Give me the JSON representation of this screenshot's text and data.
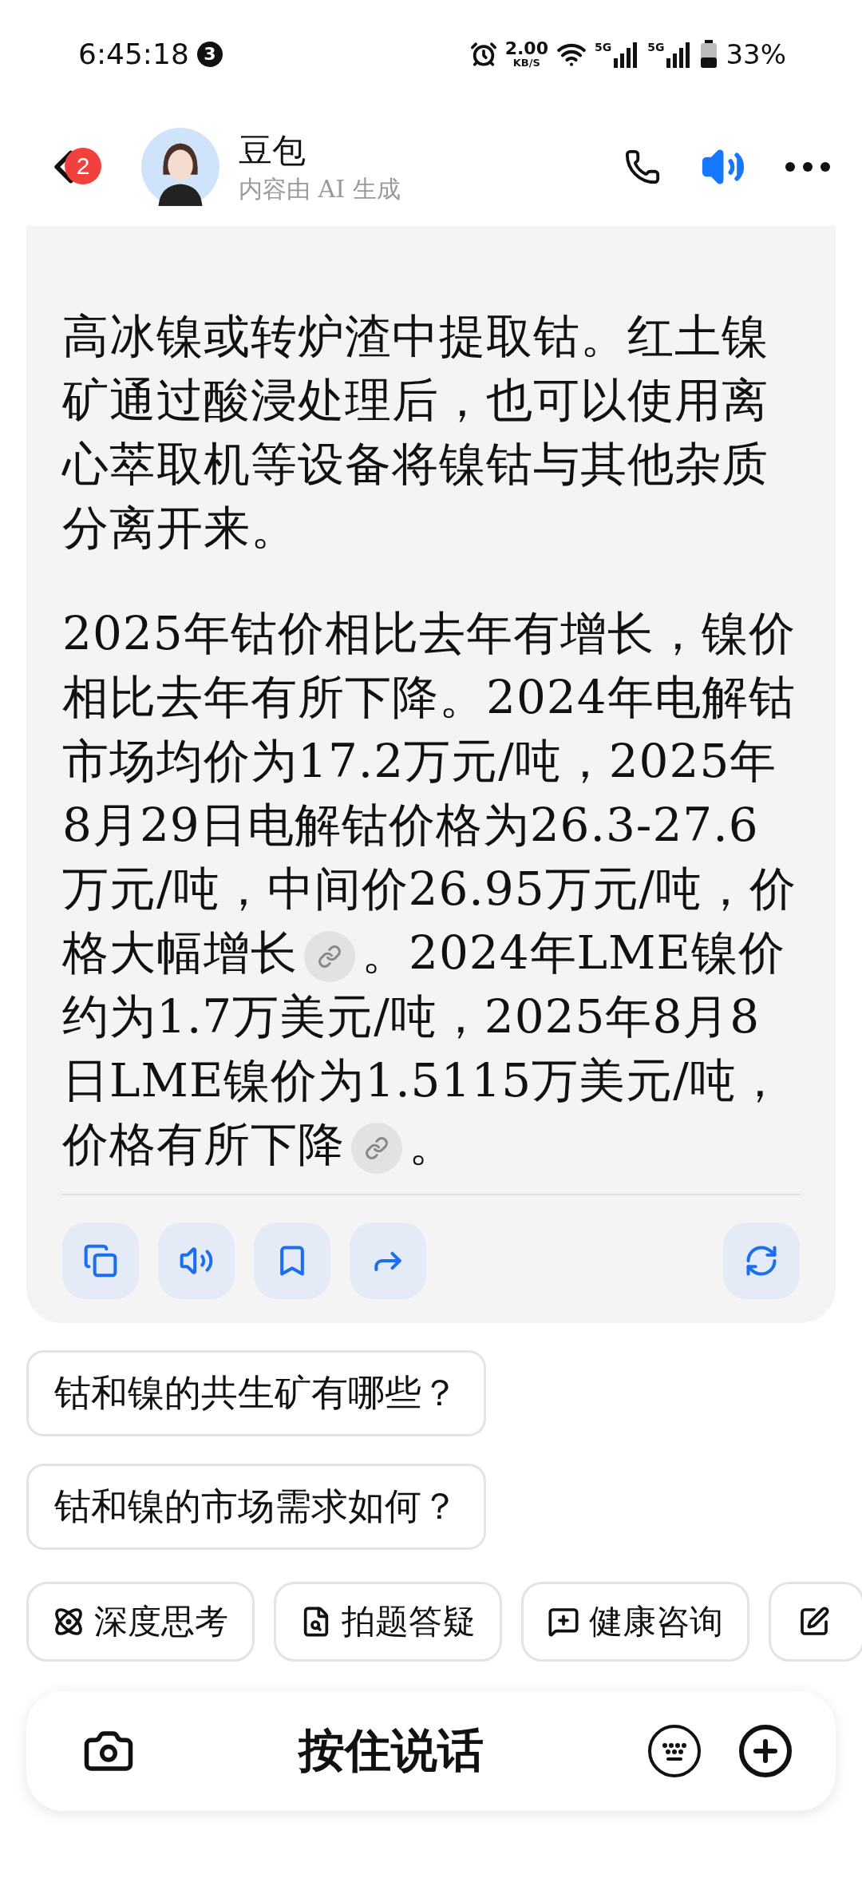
{
  "status_bar": {
    "time": "6:45:18",
    "notification_count": "3",
    "net_speed": "2.00",
    "net_unit": "KB/S",
    "sim_labels": [
      "5G",
      "5G"
    ],
    "battery": "33%"
  },
  "header": {
    "back_badge": "2",
    "name": "豆包",
    "subtitle": "内容由 AI 生成"
  },
  "message": {
    "paragraphs": [
      {
        "segments": [
          {
            "kind": "text",
            "text": "高冰镍或转炉渣中提取钴。红土镍矿通过酸浸处理后，也可以使用离心萃取机等设备将镍钴与其他杂质分离开来。"
          }
        ]
      },
      {
        "segments": [
          {
            "kind": "text",
            "text": "2025年钴价相比去年有增长，镍价相比去年有所下降。2024年电解钴市场均价为17.2万元/吨，2025年8月29日电解钴价格为26.3-27.6万元/吨，中间价26.95万元/吨，价格大幅增长"
          },
          {
            "kind": "link"
          },
          {
            "kind": "text",
            "text": "。2024年LME镍价约为1.7万美元/吨，2025年8月8日LME镍价为1.5115万美元/吨，价格有所下降"
          },
          {
            "kind": "link"
          },
          {
            "kind": "text",
            "text": "。"
          }
        ]
      }
    ],
    "actions": [
      {
        "kind": "copy"
      },
      {
        "kind": "speak"
      },
      {
        "kind": "bookmark"
      },
      {
        "kind": "share"
      },
      {
        "kind": "regenerate"
      }
    ]
  },
  "suggestions": [
    "钴和镍的共生矿有哪些？",
    "钴和镍的市场需求如何？"
  ],
  "tools": [
    {
      "kind": "deep_think",
      "label": "深度思考"
    },
    {
      "kind": "photo_question",
      "label": "拍题答疑"
    },
    {
      "kind": "health",
      "label": "健康咨询"
    },
    {
      "kind": "write"
    }
  ],
  "input_bar": {
    "hold_to_talk": "按住说话"
  }
}
